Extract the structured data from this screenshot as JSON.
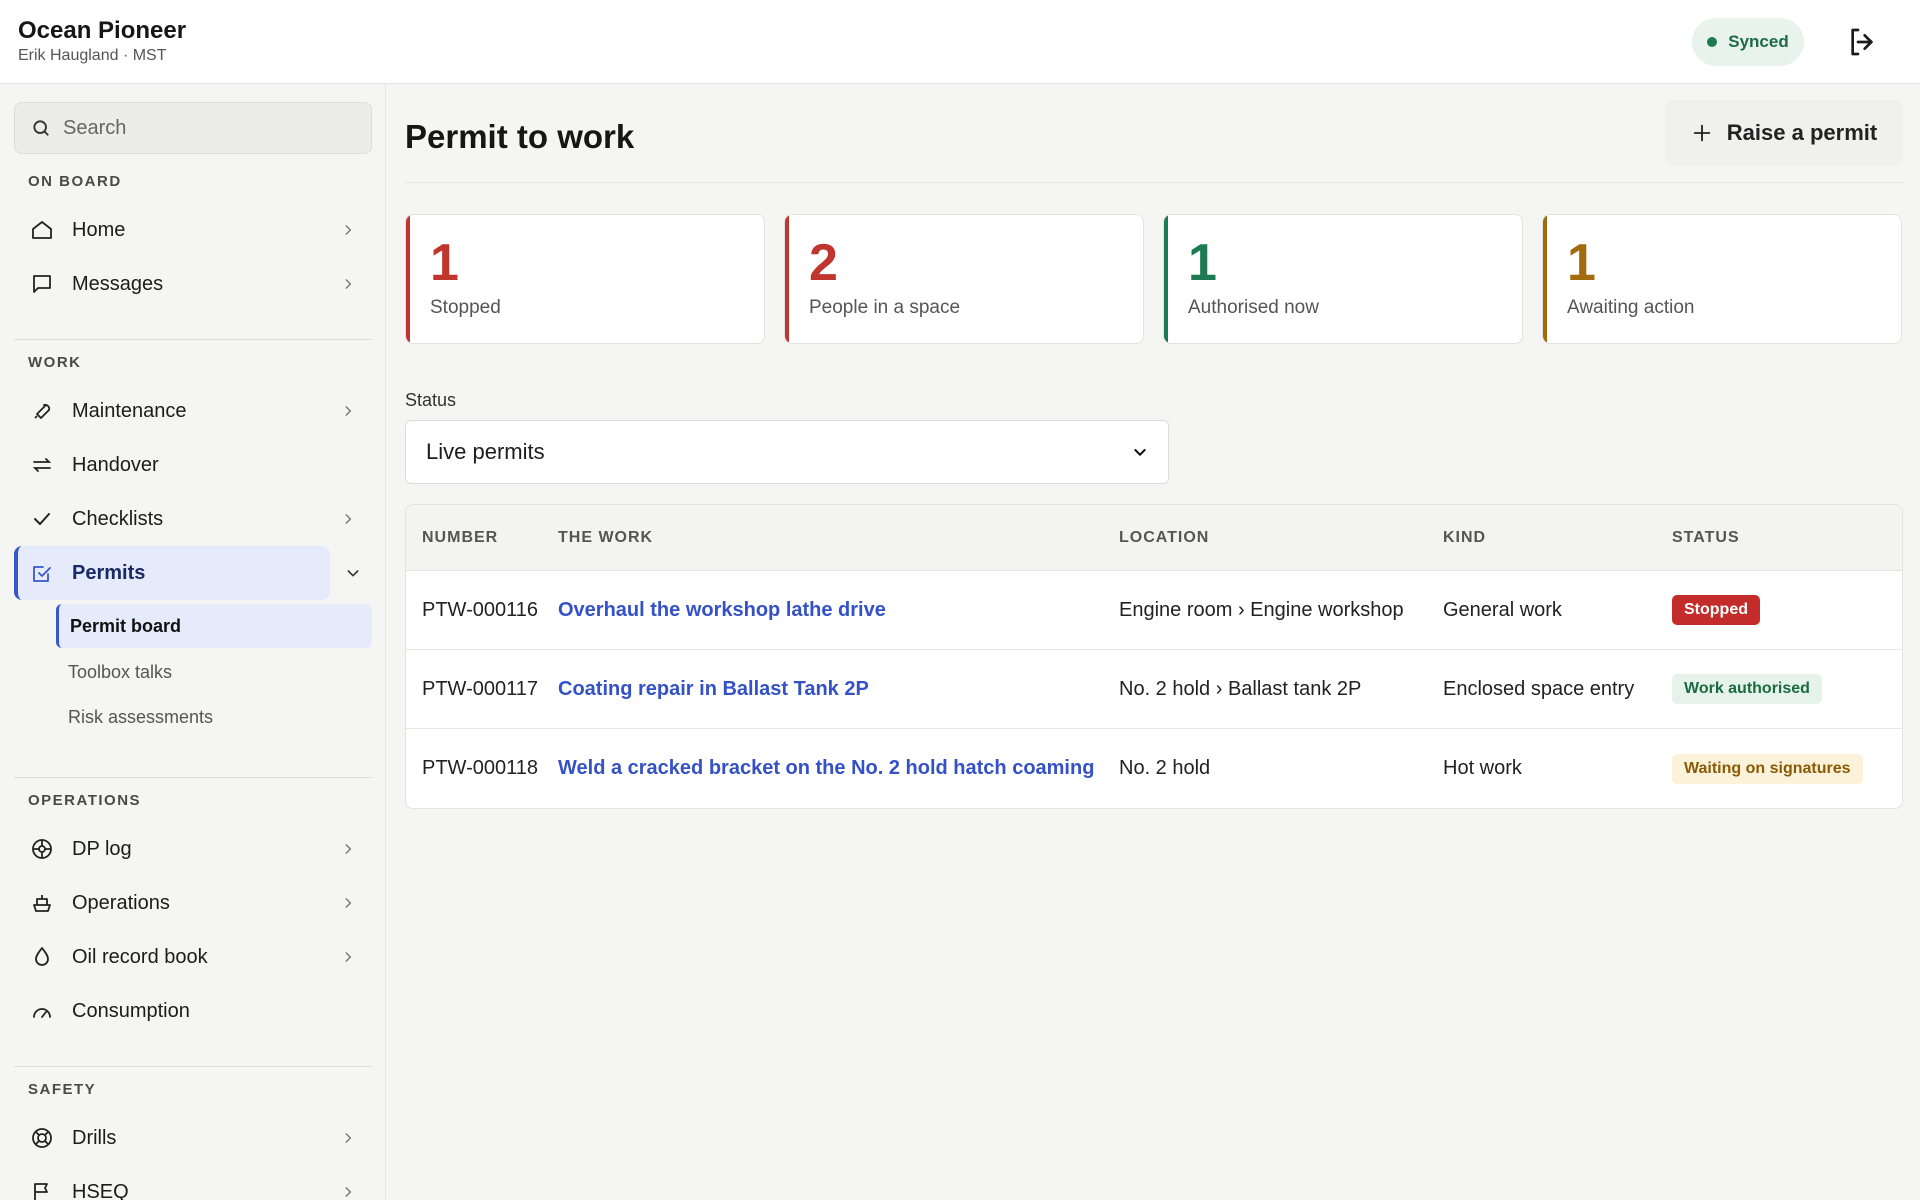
{
  "header": {
    "vessel_name": "Ocean Pioneer",
    "user_line": "Erik Haugland · MST",
    "sync_status": "Synced"
  },
  "sidebar": {
    "search_placeholder": "Search",
    "sections": {
      "on_board": "ON BOARD",
      "work": "WORK",
      "operations": "OPERATIONS",
      "safety": "SAFETY"
    },
    "items": {
      "home": "Home",
      "messages": "Messages",
      "maintenance": "Maintenance",
      "handover": "Handover",
      "checklists": "Checklists",
      "permits": "Permits",
      "permit_board": "Permit board",
      "toolbox_talks": "Toolbox talks",
      "risk_assessments": "Risk assessments",
      "dp_log": "DP log",
      "operations": "Operations",
      "oil_record_book": "Oil record book",
      "consumption": "Consumption",
      "drills": "Drills",
      "hseq": "HSEQ"
    }
  },
  "main": {
    "title": "Permit to work",
    "raise_button": "Raise a permit",
    "stats": [
      {
        "value": "1",
        "caption": "Stopped",
        "color": "#c0362f"
      },
      {
        "value": "2",
        "caption": "People in a space",
        "color": "#c0362f"
      },
      {
        "value": "1",
        "caption": "Authorised now",
        "color": "#1e7a52"
      },
      {
        "value": "1",
        "caption": "Awaiting action",
        "color": "#a26c0c"
      }
    ],
    "filter": {
      "label": "Status",
      "selected": "Live permits"
    },
    "table": {
      "headers": [
        "NUMBER",
        "THE WORK",
        "LOCATION",
        "KIND",
        "STATUS"
      ],
      "rows": [
        {
          "number": "PTW-000116",
          "work": "Overhaul the workshop lathe drive",
          "location": "Engine room › Engine workshop",
          "kind": "General work",
          "status": "Stopped"
        },
        {
          "number": "PTW-000117",
          "work": "Coating repair in Ballast Tank 2P",
          "location": "No. 2 hold › Ballast tank 2P",
          "kind": "Enclosed space entry",
          "status": "Work authorised"
        },
        {
          "number": "PTW-000118",
          "work": "Weld a cracked bracket on the No. 2 hold hatch coaming",
          "location": "No. 2 hold",
          "kind": "Hot work",
          "status": "Waiting on signatures"
        }
      ]
    }
  }
}
